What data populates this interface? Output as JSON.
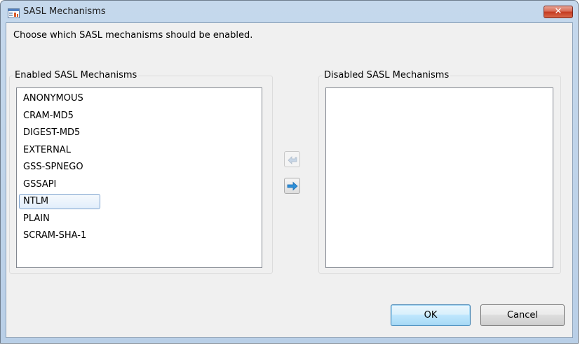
{
  "window": {
    "title": "SASL Mechanisms",
    "close_glyph": "✕"
  },
  "dialog": {
    "instruction": "Choose which SASL mechanisms should be enabled."
  },
  "enabled_group": {
    "label": "Enabled SASL Mechanisms",
    "items": [
      "ANONYMOUS",
      "CRAM-MD5",
      "DIGEST-MD5",
      "EXTERNAL",
      "GSS-SPNEGO",
      "GSSAPI",
      "NTLM",
      "PLAIN",
      "SCRAM-SHA-1"
    ],
    "selected_index": 6
  },
  "disabled_group": {
    "label": "Disabled SASL Mechanisms",
    "items": []
  },
  "move_buttons": {
    "enable_icon": "arrow-left-icon",
    "disable_icon": "arrow-right-icon",
    "enable_disabled": true
  },
  "footer": {
    "ok_label": "OK",
    "cancel_label": "Cancel"
  },
  "colors": {
    "accent": "#3c7fb1",
    "arrow": "#2d8fd8",
    "close": "#c4391f"
  }
}
